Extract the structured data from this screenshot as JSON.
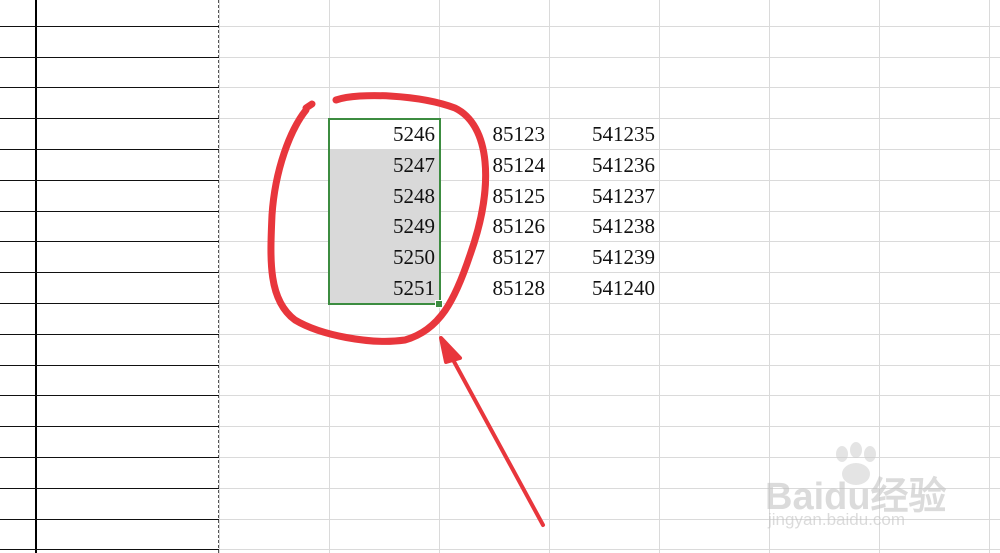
{
  "sheet": {
    "rows": [
      [
        "5246",
        "85123",
        "541235"
      ],
      [
        "5247",
        "85124",
        "541236"
      ],
      [
        "5248",
        "85125",
        "541237"
      ],
      [
        "5249",
        "85126",
        "541238"
      ],
      [
        "5250",
        "85127",
        "541239"
      ],
      [
        "5251",
        "85128",
        "541240"
      ]
    ]
  },
  "selection": {
    "selected_rows": 6,
    "selected_column": 1
  },
  "colors": {
    "selection_border": "#3c8c40",
    "selected_fill": "#d9d9d9",
    "annotation": "#e8363c",
    "gridline": "#d4d4d4",
    "table_border": "#000000"
  },
  "watermark": {
    "logo_text": "Baidu经验",
    "url": "jingyan.baidu.com"
  }
}
